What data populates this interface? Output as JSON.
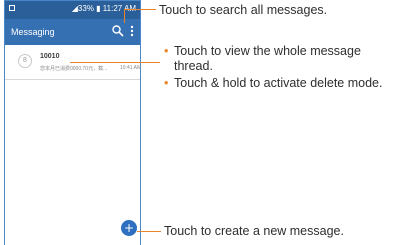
{
  "status_bar": {
    "time_text": "◢33% ▮ 11:27 AM"
  },
  "app_bar": {
    "title": "Messaging",
    "search_icon": "search-icon",
    "menu_icon": "more-vert-icon"
  },
  "thread": {
    "avatar_char": "8",
    "sender": "10010",
    "snippet": "您本月已消费0000.70元，截...",
    "time": "10:41 AM"
  },
  "fab": {
    "label": "+"
  },
  "callouts": {
    "search": "Touch to search all messages.",
    "thread_bullets": [
      {
        "bullet": "•",
        "line1": "Touch to view the whole message",
        "line2": "thread."
      },
      {
        "bullet": "•",
        "line1": "Touch & hold to activate delete mode.",
        "line2": ""
      }
    ],
    "new_message": "Touch to create a new message."
  },
  "colors": {
    "accent": "#e9862b",
    "app_bar": "#3570b3",
    "status_bar": "#2b5f99"
  }
}
